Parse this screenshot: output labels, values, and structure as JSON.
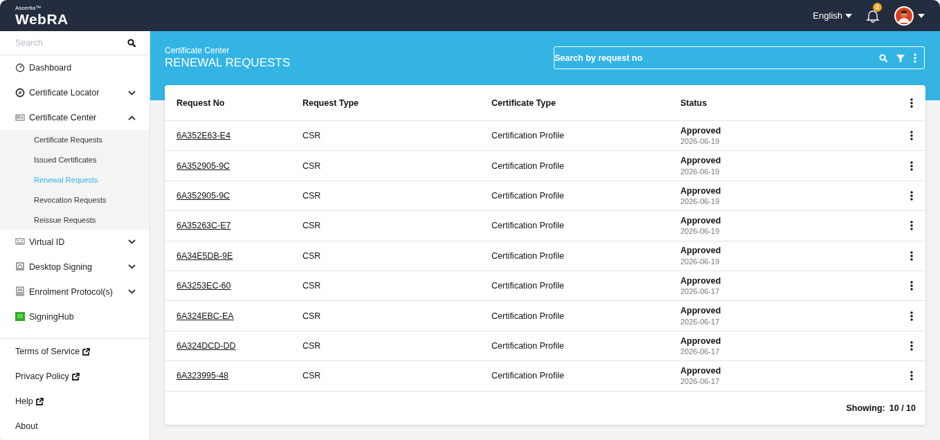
{
  "topbar": {
    "brand_small": "Ascertia™",
    "brand": "WebRA",
    "language": "English",
    "notification_count": "2"
  },
  "sidebar": {
    "search": {
      "placeholder": "Search"
    },
    "items": [
      {
        "label": "Dashboard"
      },
      {
        "label": "Certificate Locator",
        "expanded": false
      },
      {
        "label": "Certificate Center",
        "expanded": true,
        "children": [
          {
            "label": "Certificate Requests",
            "selected": false
          },
          {
            "label": "Issued Certificates",
            "selected": false
          },
          {
            "label": "Renewal Requests",
            "selected": true
          },
          {
            "label": "Revocation Requests",
            "selected": false
          },
          {
            "label": "Reissue Requests",
            "selected": false
          }
        ]
      },
      {
        "label": "Virtual ID",
        "expanded": false
      },
      {
        "label": "Desktop Signing",
        "expanded": false
      },
      {
        "label": "Enrolment Protocol(s)",
        "expanded": false
      },
      {
        "label": "SigningHub"
      }
    ],
    "footer_links": [
      {
        "label": "Terms of Service",
        "external": true
      },
      {
        "label": "Privacy Policy",
        "external": true
      },
      {
        "label": "Help",
        "external": true
      },
      {
        "label": "About",
        "external": false
      }
    ]
  },
  "header": {
    "breadcrumb": "Certificate Center",
    "title": "RENEWAL REQUESTS",
    "search": {
      "placeholder": "Search by request no"
    }
  },
  "table": {
    "columns": [
      "Request No",
      "Request Type",
      "Certificate Type",
      "Status"
    ],
    "rows": [
      {
        "request_no": "6A352E63-E4",
        "request_type": "CSR",
        "certificate_type": "Certification Profile",
        "status": "Approved",
        "date": "2026-06-19"
      },
      {
        "request_no": "6A352905-9C",
        "request_type": "CSR",
        "certificate_type": "Certification Profile",
        "status": "Approved",
        "date": "2026-06-19"
      },
      {
        "request_no": "6A352905-9C",
        "request_type": "CSR",
        "certificate_type": "Certification Profile",
        "status": "Approved",
        "date": "2026-06-19"
      },
      {
        "request_no": "6A35263C-E7",
        "request_type": "CSR",
        "certificate_type": "Certification Profile",
        "status": "Approved",
        "date": "2026-06-19"
      },
      {
        "request_no": "6A34E5DB-9E",
        "request_type": "CSR",
        "certificate_type": "Certification Profile",
        "status": "Approved",
        "date": "2026-06-19"
      },
      {
        "request_no": "6A3253EC-60",
        "request_type": "CSR",
        "certificate_type": "Certification Profile",
        "status": "Approved",
        "date": "2026-06-17"
      },
      {
        "request_no": "6A324EBC-EA",
        "request_type": "CSR",
        "certificate_type": "Certification Profile",
        "status": "Approved",
        "date": "2026-06-17"
      },
      {
        "request_no": "6A324DCD-DD",
        "request_type": "CSR",
        "certificate_type": "Certification Profile",
        "status": "Approved",
        "date": "2026-06-17"
      },
      {
        "request_no": "6A323995-48",
        "request_type": "CSR",
        "certificate_type": "Certification Profile",
        "status": "Approved",
        "date": "2026-06-17"
      }
    ],
    "footer": {
      "label": "Showing:",
      "count": "10 / 10"
    }
  }
}
